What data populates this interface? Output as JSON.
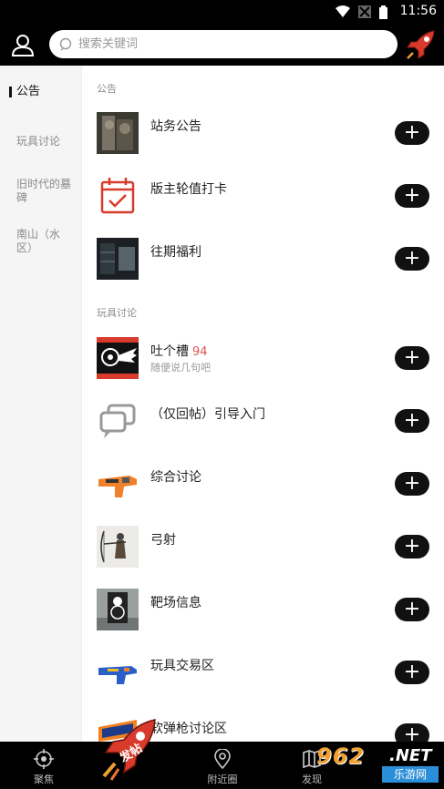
{
  "status_bar": {
    "time": "11:56"
  },
  "header": {
    "search_placeholder": "搜索关键词"
  },
  "sidebar": {
    "items": [
      {
        "label": "公告",
        "active": true
      },
      {
        "label": "玩具讨论",
        "active": false
      },
      {
        "label": "旧时代的墓碑",
        "active": false
      },
      {
        "label": "南山（水区）",
        "active": false
      }
    ]
  },
  "sections": [
    {
      "title": "公告",
      "rows": [
        {
          "name": "站务公告",
          "thumb": "sculpture-photo"
        },
        {
          "name": "版主轮值打卡",
          "thumb": "calendar-check-icon"
        },
        {
          "name": "往期福利",
          "thumb": "dark-room-photo"
        }
      ]
    },
    {
      "title": "玩具讨论",
      "rows": [
        {
          "name": "吐个槽",
          "count": "94",
          "subtitle": "随便说几句吧",
          "thumb": "winged-target-logo"
        },
        {
          "name": "（仅回帖）引导入门",
          "thumb": "chat-bubbles-icon"
        },
        {
          "name": "综合讨论",
          "thumb": "orange-blaster-photo"
        },
        {
          "name": "弓射",
          "thumb": "archer-photo"
        },
        {
          "name": "靶场信息",
          "thumb": "target-range-photo"
        },
        {
          "name": "玩具交易区",
          "thumb": "blue-blaster-photo"
        },
        {
          "name": "软弹枪讨论区",
          "thumb": "nerf-logo"
        }
      ]
    }
  ],
  "add_button_symbol": "+",
  "bottom_nav": {
    "items": [
      {
        "label": "聚焦",
        "icon": "crosshair-icon"
      },
      {
        "label": "附近圈",
        "icon": "location-pin-icon"
      },
      {
        "label": "发现",
        "icon": "map-icon"
      }
    ],
    "post_label": "发帖",
    "rocket_badge": "发帖"
  },
  "watermark": {
    "number": "962",
    "suffix": ".NET",
    "text": "乐游网"
  },
  "colors": {
    "bar_bg": "#000000",
    "sidebar_bg": "#f5f5f5",
    "accent_red": "#d83a2c",
    "count_red": "#e05252"
  }
}
